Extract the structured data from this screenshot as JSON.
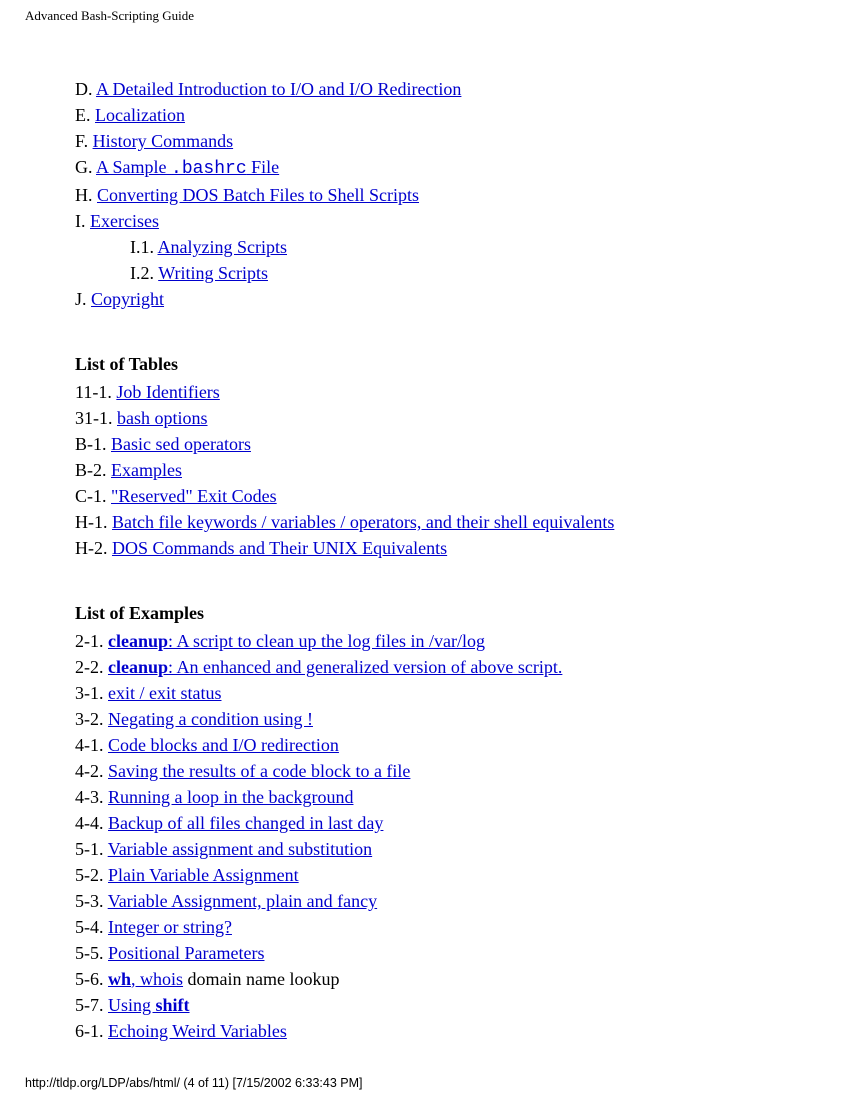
{
  "header": {
    "title": "Advanced Bash-Scripting Guide"
  },
  "appendix": {
    "items": [
      {
        "marker": "D.",
        "text": "A Detailed Introduction to I/O and I/O Redirection"
      },
      {
        "marker": "E.",
        "text": "Localization"
      },
      {
        "marker": "F.",
        "text": "History Commands"
      },
      {
        "marker": "G.",
        "prefix": "A Sample ",
        "code": ".bashrc",
        "suffix": " File"
      },
      {
        "marker": "H.",
        "text": "Converting DOS Batch Files to Shell Scripts"
      },
      {
        "marker": "I.",
        "text": "Exercises"
      },
      {
        "marker": "J.",
        "text": "Copyright"
      }
    ],
    "sub_items": [
      {
        "marker": "I.1.",
        "text": "Analyzing Scripts"
      },
      {
        "marker": "I.2.",
        "text": "Writing Scripts"
      }
    ]
  },
  "tables": {
    "heading": "List of Tables",
    "items": [
      {
        "marker": "11-1.",
        "text": "Job Identifiers"
      },
      {
        "marker": "31-1.",
        "text": "bash options"
      },
      {
        "marker": "B-1.",
        "text": "Basic sed operators"
      },
      {
        "marker": "B-2.",
        "text": "Examples"
      },
      {
        "marker": "C-1.",
        "text": "\"Reserved\" Exit Codes"
      },
      {
        "marker": "H-1.",
        "text": "Batch file keywords / variables / operators, and their shell equivalents"
      },
      {
        "marker": "H-2.",
        "text": "DOS Commands and Their UNIX Equivalents"
      }
    ]
  },
  "examples": {
    "heading": "List of Examples",
    "items": [
      {
        "marker": "2-1.",
        "bold": "cleanup",
        "rest": ": A script to clean up the log files in /var/log"
      },
      {
        "marker": "2-2.",
        "bold": "cleanup",
        "rest": ": An enhanced and generalized version of above script."
      },
      {
        "marker": "3-1.",
        "text": "exit / exit status"
      },
      {
        "marker": "3-2.",
        "text": "Negating a condition using !"
      },
      {
        "marker": "4-1.",
        "text": "Code blocks and I/O redirection"
      },
      {
        "marker": "4-2.",
        "text": "Saving the results of a code block to a file"
      },
      {
        "marker": "4-3.",
        "text": "Running a loop in the background"
      },
      {
        "marker": "4-4.",
        "text": "Backup of all files changed in last day"
      },
      {
        "marker": "5-1.",
        "text": "Variable assignment and substitution"
      },
      {
        "marker": "5-2.",
        "text": "Plain Variable Assignment"
      },
      {
        "marker": "5-3.",
        "text": "Variable Assignment, plain and fancy"
      },
      {
        "marker": "5-4.",
        "text": "Integer or string?"
      },
      {
        "marker": "5-5.",
        "text": "Positional Parameters"
      },
      {
        "marker": "5-6.",
        "bold": "wh",
        "rest": ", whois",
        "after": " domain name lookup"
      },
      {
        "marker": "5-7.",
        "prefix": "Using ",
        "bold": "shift"
      },
      {
        "marker": "6-1.",
        "text": "Echoing Weird Variables"
      }
    ]
  },
  "footer": {
    "text": "http://tldp.org/LDP/abs/html/ (4 of 11) [7/15/2002 6:33:43 PM]"
  }
}
